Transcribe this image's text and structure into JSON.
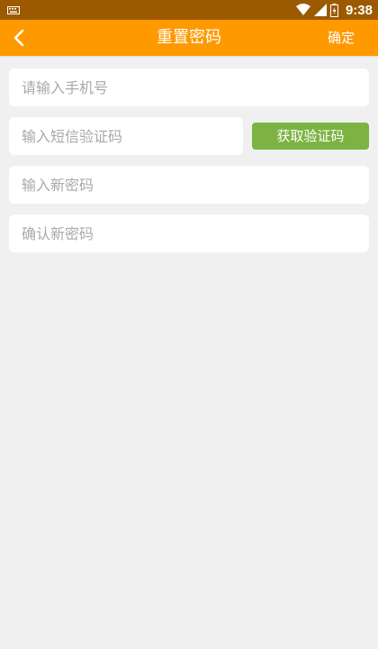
{
  "status_bar": {
    "time": "9:38",
    "icons": [
      "keyboard-icon",
      "wifi-icon",
      "signal-icon",
      "battery-icon"
    ]
  },
  "app_bar": {
    "title": "重置密码",
    "confirm_label": "确定",
    "back_icon": "chevron-left-icon",
    "background": "#ff9900"
  },
  "form": {
    "phone_placeholder": "请输入手机号",
    "sms_code_placeholder": "输入短信验证码",
    "get_code_label": "获取验证码",
    "get_code_color": "#7cb342",
    "new_password_placeholder": "输入新密码",
    "confirm_password_placeholder": "确认新密码"
  }
}
